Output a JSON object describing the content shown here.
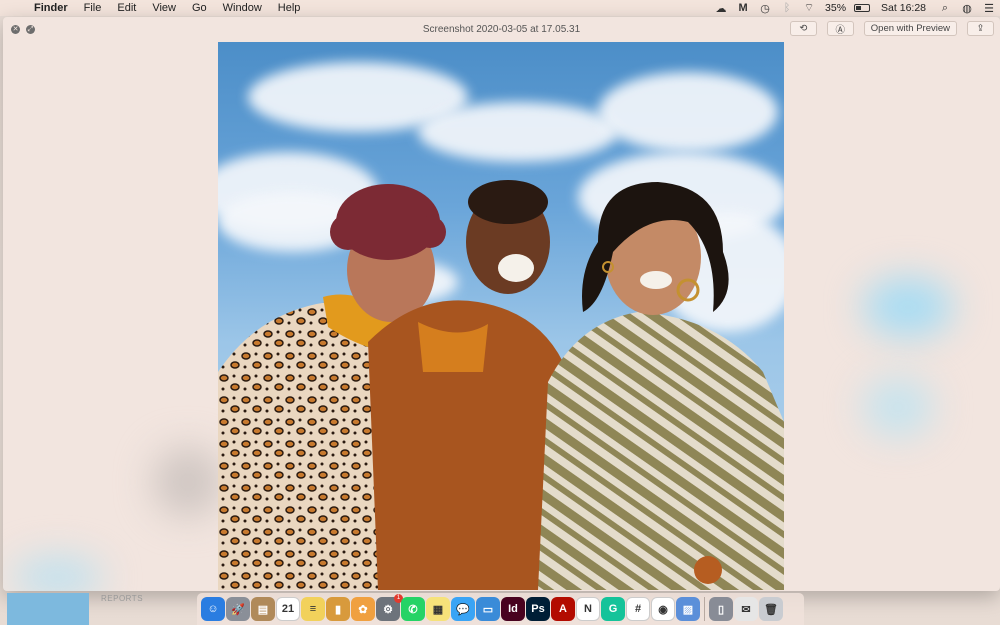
{
  "menubar": {
    "app_name": "Finder",
    "menus": [
      "File",
      "Edit",
      "View",
      "Go",
      "Window",
      "Help"
    ],
    "battery_percent": "35%",
    "clock": "Sat 16:28"
  },
  "quicklook": {
    "title": "Screenshot 2020-03-05 at 17.05.31",
    "open_with_label": "Open with Preview"
  },
  "desktop": {
    "label": "REPORTS"
  },
  "dock": {
    "apps": [
      {
        "name": "Finder",
        "color": "#2a7de1",
        "glyph": "☺"
      },
      {
        "name": "Launchpad",
        "color": "#8a8f98",
        "glyph": "🚀"
      },
      {
        "name": "Notebook",
        "color": "#b08a5a",
        "glyph": "▤"
      },
      {
        "name": "Calendar",
        "color": "#ffffff",
        "glyph": "21"
      },
      {
        "name": "Notes",
        "color": "#f2d15b",
        "glyph": "≡"
      },
      {
        "name": "Notefile",
        "color": "#d89a3c",
        "glyph": "▮"
      },
      {
        "name": "Photos",
        "color": "#f0a040",
        "glyph": "✿"
      },
      {
        "name": "System Preferences",
        "color": "#6d737b",
        "glyph": "⚙",
        "badge": "1"
      },
      {
        "name": "WhatsApp",
        "color": "#25d366",
        "glyph": "✆"
      },
      {
        "name": "Stickies",
        "color": "#f6e27a",
        "glyph": "▦"
      },
      {
        "name": "Messages",
        "color": "#3aa4f5",
        "glyph": "💬"
      },
      {
        "name": "Keynote",
        "color": "#3a8bd8",
        "glyph": "▭"
      },
      {
        "name": "InDesign",
        "color": "#49021f",
        "glyph": "Id"
      },
      {
        "name": "Photoshop",
        "color": "#001e36",
        "glyph": "Ps"
      },
      {
        "name": "Acrobat",
        "color": "#b30b00",
        "glyph": "A"
      },
      {
        "name": "Notion",
        "color": "#ffffff",
        "glyph": "N"
      },
      {
        "name": "Grammarly",
        "color": "#15c39a",
        "glyph": "G"
      },
      {
        "name": "Slack",
        "color": "#ffffff",
        "glyph": "#"
      },
      {
        "name": "Chrome",
        "color": "#ffffff",
        "glyph": "◉"
      },
      {
        "name": "Preview",
        "color": "#5b8fd9",
        "glyph": "▨"
      },
      {
        "name": "Phone",
        "color": "#888c96",
        "glyph": "▯"
      },
      {
        "name": "Mail",
        "color": "#e6e6e6",
        "glyph": "✉"
      },
      {
        "name": "Trash",
        "color": "#c9ccd1",
        "glyph": "🗑"
      }
    ]
  }
}
